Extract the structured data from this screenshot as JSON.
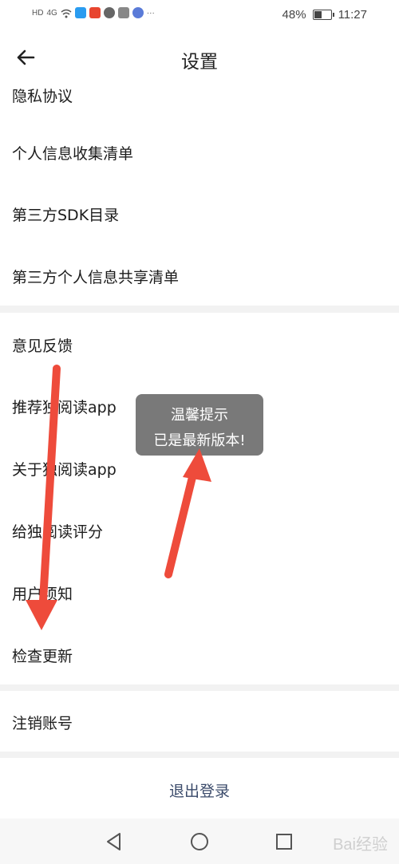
{
  "status_bar": {
    "network": "HD",
    "signal": "4G",
    "battery_percent": "48%",
    "time": "11:27",
    "more_indicator": "···"
  },
  "header": {
    "title": "设置"
  },
  "settings_items": [
    "隐私协议",
    "个人信息收集清单",
    "第三方SDK目录",
    "第三方个人信息共享清单",
    "意见反馈",
    "推荐独阅读app",
    "关于独阅读app",
    "给独阅读评分",
    "用户须知",
    "检查更新",
    "注销账号"
  ],
  "logout_label": "退出登录",
  "toast": {
    "title": "温馨提示",
    "message": "已是最新版本!"
  },
  "watermark": "Bai经验",
  "colors": {
    "arrow": "#ee4b3b",
    "toast_bg": "#6e6e6e",
    "logout_text": "#3a4a6a"
  },
  "icons": [
    "back-arrow-icon",
    "nav-back-icon",
    "nav-home-icon",
    "nav-recent-icon"
  ]
}
